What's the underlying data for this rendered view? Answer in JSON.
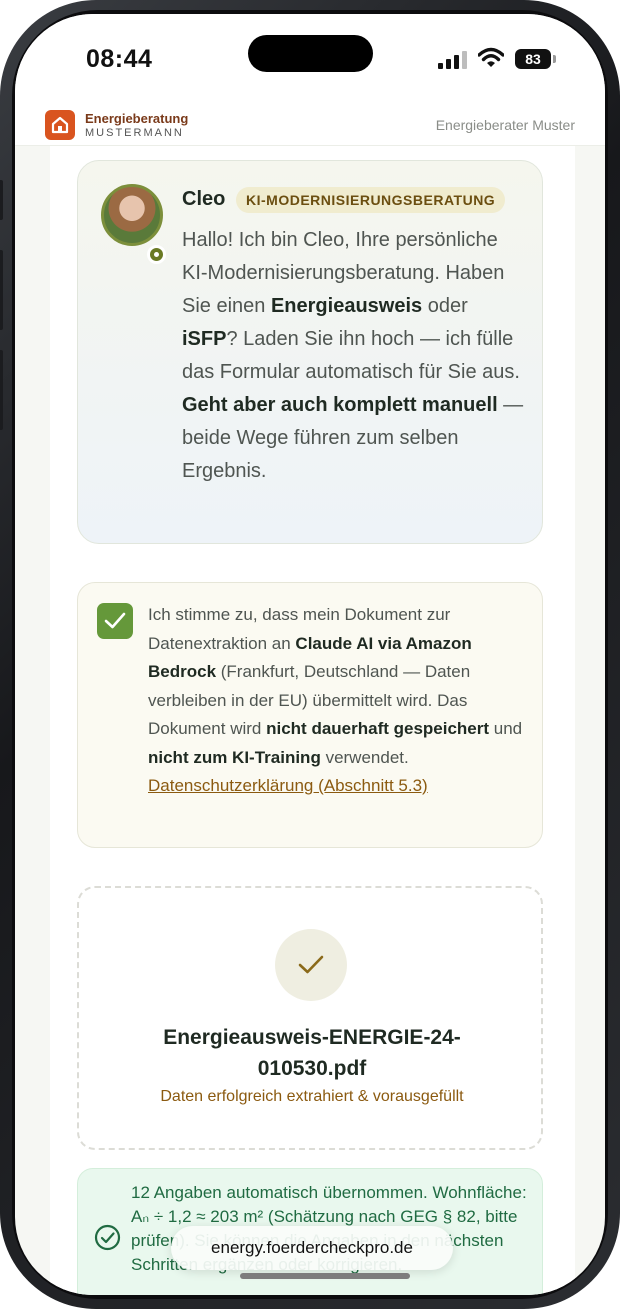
{
  "status_bar": {
    "time": "08:44",
    "battery": "83"
  },
  "header": {
    "brand_line1": "Energieberatung",
    "brand_line2": "MUSTERMANN",
    "advisor": "Energieberater Muster",
    "logo_icon": "house-icon",
    "brand_color": "#d9541f"
  },
  "chat": {
    "name": "Cleo",
    "badge": "KI-MODERNISIERUNGSBERATUNG",
    "message_parts": [
      "Hallo! Ich bin Cleo, Ihre persönliche KI-Modernisierungsberatung. Haben Sie einen ",
      "Energieausweis",
      " oder ",
      "iSFP",
      "? Laden Sie ihn hoch — ich fülle das Formular automatisch für Sie aus. ",
      "Geht aber auch komplett manuell",
      " — beide Wege führen zum selben Ergebnis."
    ]
  },
  "consent": {
    "checked": true,
    "text_parts": [
      "Ich stimme zu, dass mein Dokument zur Datenextraktion an ",
      "Claude AI via Amazon Bedrock",
      " (Frankfurt, Deutschland — Daten verbleiben in der EU) übermittelt wird. Das Dokument wird ",
      "nicht dauerhaft gespeichert",
      " und ",
      "nicht zum KI-Training",
      " verwendet. "
    ],
    "link": "Datenschutzerklärung (Abschnitt 5.3)",
    "accent_color": "#65983a"
  },
  "upload": {
    "file_name": "Energieausweis-ENERGIE-24-010530.pdf",
    "status": "Daten erfolgreich extrahiert & vorausgefüllt",
    "icon": "check-icon"
  },
  "result": {
    "text": "12 Angaben automatisch übernommen. Wohnfläche: Aₙ ÷ 1,2 ≈ 203 m² (Schätzung nach GEG § 82, bitte prüfen). Sie können die Angaben in den nächsten Schritten ergänzen oder korrigieren.",
    "icon": "check-circle-icon",
    "color": "#206b42"
  },
  "browser": {
    "url": "energy.foerdercheckpro.de"
  }
}
